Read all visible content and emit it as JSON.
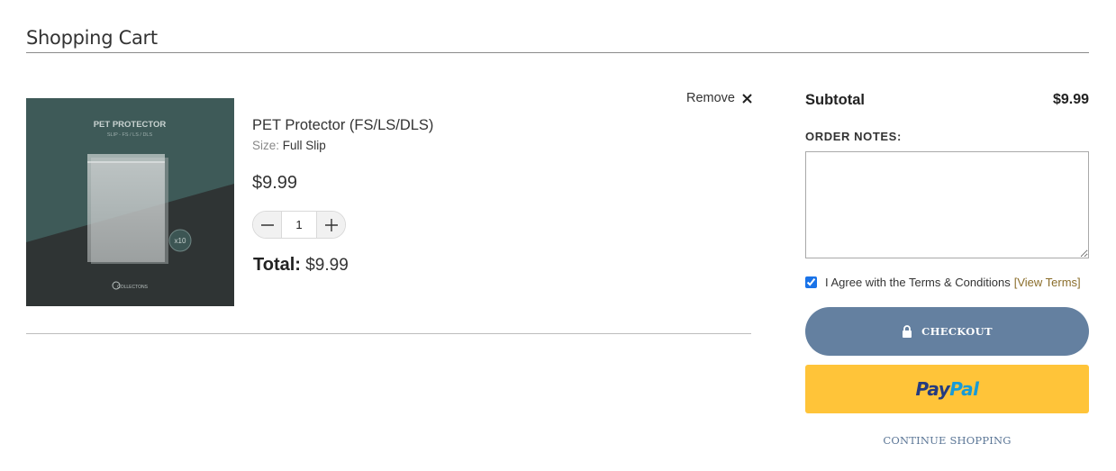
{
  "page": {
    "title": "Shopping Cart"
  },
  "item": {
    "name": "PET Protector (FS/LS/DLS)",
    "size_label": "Size:",
    "size_value": "Full Slip",
    "price": "$9.99",
    "quantity": "1",
    "total_label": "Total:",
    "total_value": "$9.99",
    "remove_label": "Remove",
    "image": {
      "heading": "PET PROTECTOR",
      "subheading": "SLIP - FS / LS / DLS",
      "badge": "x10",
      "brand": "COLLECTONS"
    }
  },
  "summary": {
    "subtotal_label": "Subtotal",
    "subtotal_value": "$9.99",
    "notes_label": "ORDER NOTES:",
    "notes_value": "",
    "terms_checked": true,
    "terms_text": "I Agree with the Terms & Conditions",
    "terms_link": "[View Terms]",
    "checkout_label": "CHECKOUT",
    "paypal_part1": "Pay",
    "paypal_part2": "Pal",
    "continue_label": "CONTINUE SHOPPING"
  },
  "colors": {
    "checkout_bg": "#6480a0",
    "paypal_bg": "#ffc439",
    "terms_link": "#8a6d2a",
    "continue_link": "#5b7696"
  },
  "icons": {
    "remove": "close-icon",
    "checkout": "lock-icon",
    "qty_decrease": "minus-icon",
    "qty_increase": "plus-icon"
  }
}
